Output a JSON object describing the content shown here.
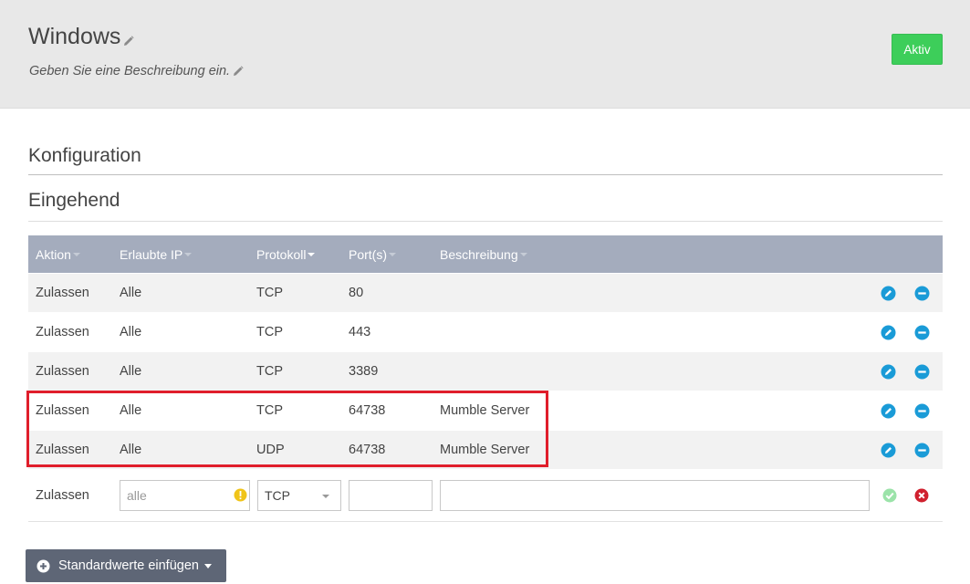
{
  "header": {
    "title": "Windows",
    "description": "Geben Sie eine Beschreibung ein.",
    "status_label": "Aktiv"
  },
  "colors": {
    "status_green": "#3dce5a",
    "table_header": "#a4acbd",
    "action_blue": "#1a9bd7",
    "highlight_red": "#e01e2b",
    "cancel_red": "#d0202e"
  },
  "sections": {
    "config_title": "Konfiguration",
    "inbound_title": "Eingehend"
  },
  "table": {
    "columns": [
      "Aktion",
      "Erlaubte IP",
      "Protokoll",
      "Port(s)",
      "Beschreibung"
    ],
    "rows": [
      {
        "aktion": "Zulassen",
        "ip": "Alle",
        "protokoll": "TCP",
        "port": "80",
        "beschreibung": ""
      },
      {
        "aktion": "Zulassen",
        "ip": "Alle",
        "protokoll": "TCP",
        "port": "443",
        "beschreibung": ""
      },
      {
        "aktion": "Zulassen",
        "ip": "Alle",
        "protokoll": "TCP",
        "port": "3389",
        "beschreibung": ""
      },
      {
        "aktion": "Zulassen",
        "ip": "Alle",
        "protokoll": "TCP",
        "port": "64738",
        "beschreibung": "Mumble Server"
      },
      {
        "aktion": "Zulassen",
        "ip": "Alle",
        "protokoll": "UDP",
        "port": "64738",
        "beschreibung": "Mumble Server"
      }
    ],
    "row_icons": {
      "edit": "pencil-circle-icon",
      "delete": "minus-circle-icon"
    }
  },
  "new_rule": {
    "aktion": "Zulassen",
    "ip_placeholder": "alle",
    "protokoll": "TCP",
    "port_value": "",
    "beschreibung_value": ""
  },
  "footer": {
    "defaults_button": "Standardwerte einfügen"
  }
}
